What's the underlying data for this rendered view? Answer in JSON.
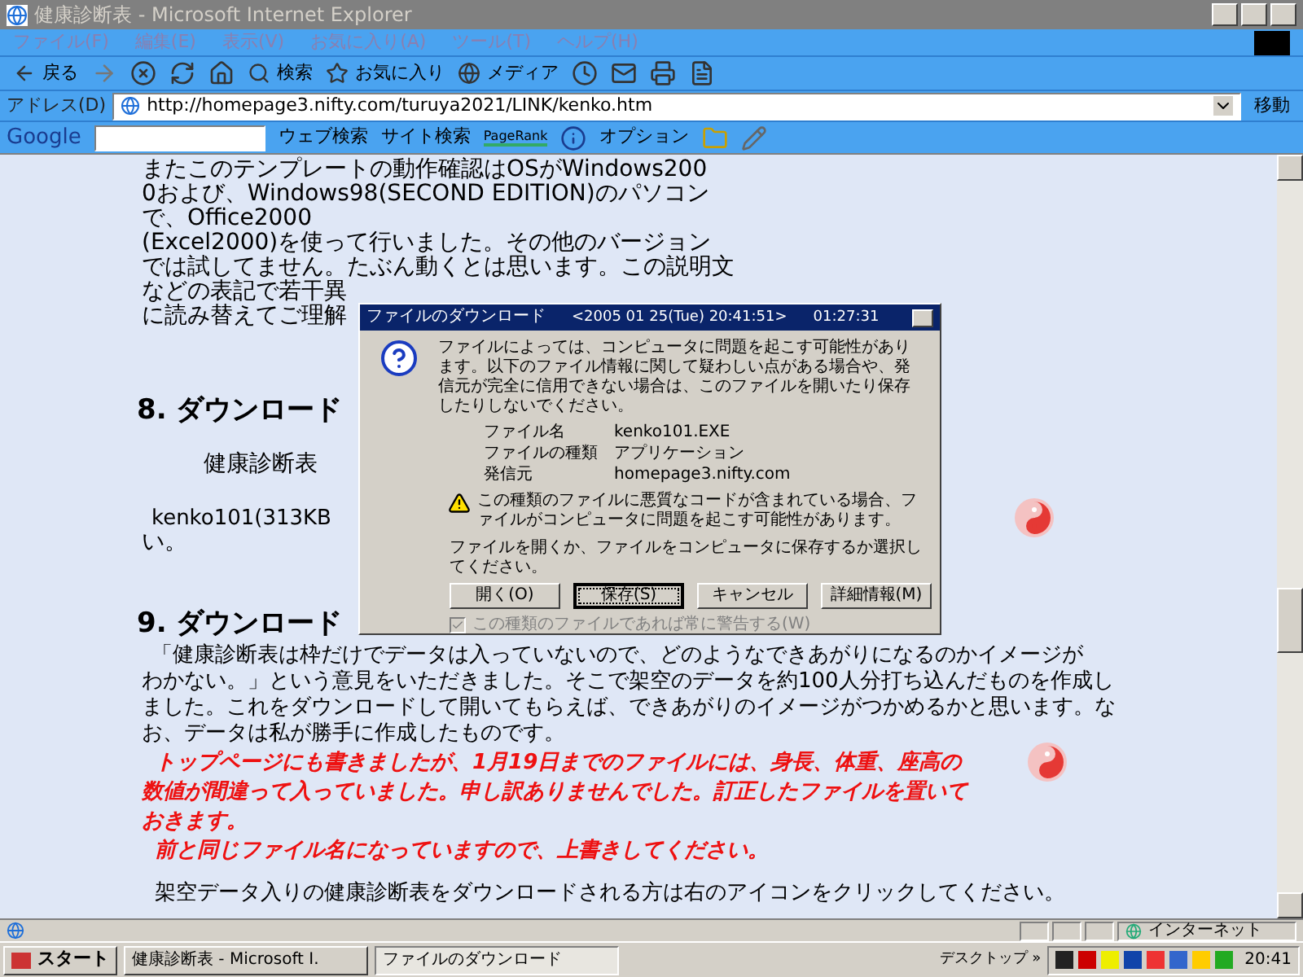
{
  "window": {
    "title": "健康診断表 - Microsoft Internet Explorer",
    "active": false
  },
  "menu": [
    "ファイル(F)",
    "編集(E)",
    "表示(V)",
    "お気に入り(A)",
    "ツール(T)",
    "ヘルプ(H)"
  ],
  "toolbar": {
    "back": "戻る",
    "search": "検索",
    "favorites": "お気に入り",
    "media": "メディア"
  },
  "address": {
    "label": "アドレス(D)",
    "value": "http://homepage3.nifty.com/turuya2021/LINK/kenko.htm",
    "go": "移動"
  },
  "google_bar": {
    "logo": "Google",
    "web_search": "ウェブ検索",
    "site_search": "サイト検索",
    "pagerank": "PageRank",
    "options": "オプション"
  },
  "page": {
    "intro_lines": [
      "またこのテンプレートの動作確認はOSがWindows200",
      "0および、Windows98(SECOND EDITION)のパソコン",
      "で、Office2000",
      "(Excel2000)を使って行いました。その他のバージョン",
      "では試してません。たぶん動くとは思います。この説明文",
      "などの表記で若干異",
      "に読み替えてご理解"
    ],
    "heading_8": "8. ダウンロード",
    "item_title": "健康診断表",
    "item_file": "kenko101(313KB",
    "item_tail": "い。",
    "heading_9": "9. ダウンロード",
    "body_lines": [
      "「健康診断表は枠だけでデータは入っていないので、どのようなできあがりになるのかイメージが",
      "わかない。」という意見をいただきました。そこで架空のデータを約100人分打ち込んだものを作成し",
      "ました。これをダウンロードして開いてもらえば、できあがりのイメージがつかめるかと思います。な",
      "お、データは私が勝手に作成したものです。"
    ],
    "notice_lines": [
      "トップページにも書きましたが、1月19日までのファイルには、身長、体重、座高の",
      "数値が間違って入っていました。申し訳ありませんでした。訂正したファイルを置いて",
      "おきます。",
      "前と同じファイル名になっていますので、上書きしてください。"
    ],
    "closing": "架空データ入りの健康診断表をダウンロードされる方は右のアイコンをクリックしてください。"
  },
  "dialog": {
    "title": "ファイルのダウンロード",
    "timestamp": "<2005 01 25(Tue) 20:41:51>",
    "timer": "01:27:31",
    "message": "ファイルによっては、コンピュータに問題を起こす可能性があります。以下のファイル情報に関して疑わしい点がある場合や、発信元が完全に信用できない場合は、このファイルを開いたり保存したりしないでください。",
    "fields": [
      {
        "label": "ファイル名",
        "value": "kenko101.EXE"
      },
      {
        "label": "ファイルの種類",
        "value": "アプリケーション"
      },
      {
        "label": "発信元",
        "value": "homepage3.nifty.com"
      }
    ],
    "warning": "この種類のファイルに悪質なコードが含まれている場合、ファイルがコンピュータに問題を起こす可能性があります。",
    "prompt": "ファイルを開くか、ファイルをコンピュータに保存するか選択してください。",
    "buttons": [
      {
        "label": "開く(O)",
        "selected": false
      },
      {
        "label": "保存(S)",
        "selected": true
      },
      {
        "label": "キャンセル",
        "selected": false
      },
      {
        "label": "詳細情報(M)",
        "selected": false
      }
    ],
    "always_warn": {
      "label": "この種類のファイルであれば常に警告する(W)",
      "checked": true,
      "disabled": true
    }
  },
  "status_bar": {
    "zone": "インターネット"
  },
  "taskbar": {
    "start": "スタート",
    "tasks": [
      {
        "label": "健康診断表 - Microsoft I.",
        "selected": false
      },
      {
        "label": "ファイルのダウンロード",
        "selected": true
      }
    ],
    "desktop": "デスクトップ »",
    "clock": "20:41"
  }
}
